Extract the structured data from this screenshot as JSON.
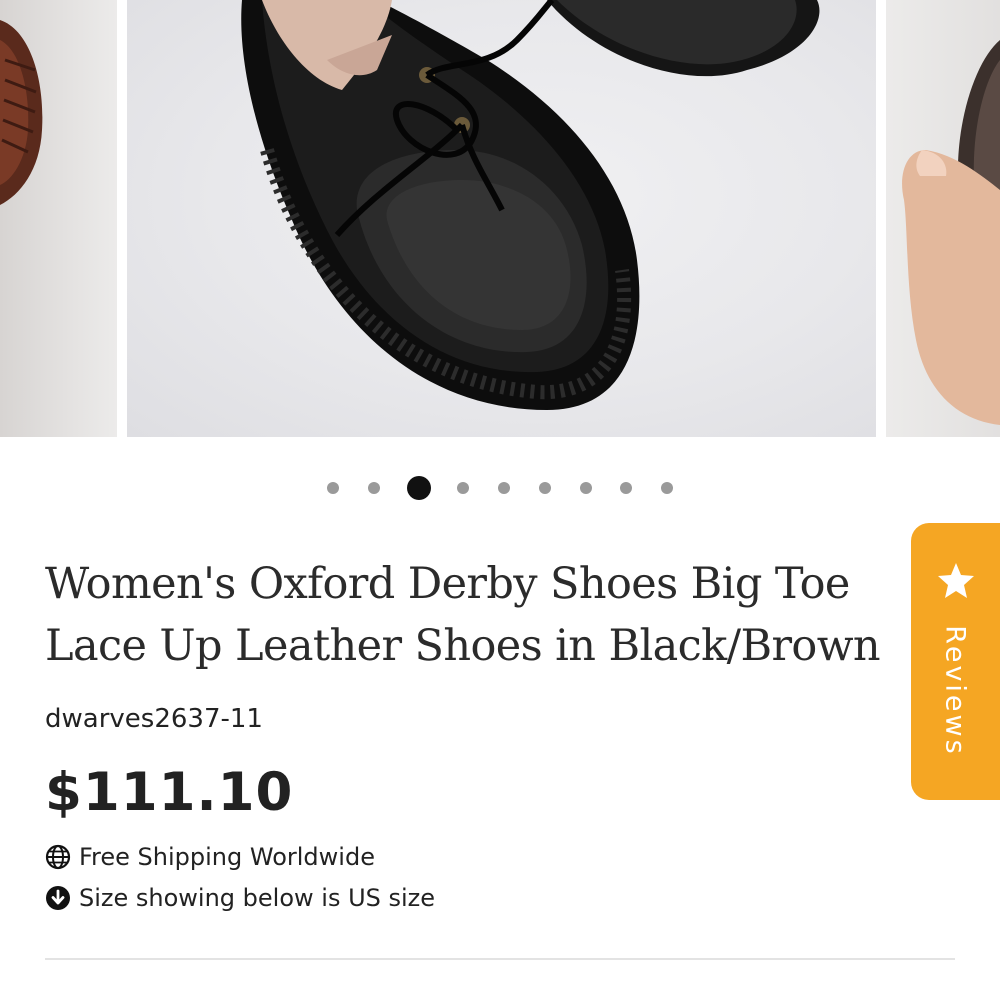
{
  "carousel": {
    "total_images": 9,
    "active_index": 2
  },
  "product": {
    "title": "Women's Oxford Derby Shoes Big Toe Lace Up Leather Shoes in Black/Brown",
    "sku": "dwarves2637-11",
    "price": "$111.10",
    "shipping_note": "Free Shipping Worldwide",
    "size_note": "Size showing below is US size"
  },
  "icons": {
    "shipping": "globe-icon",
    "size": "arrow-down-circle-icon",
    "reviews": "star-icon"
  },
  "reviews_tab": {
    "label": "Reviews",
    "color": "#f5a623"
  },
  "colors": {
    "text": "#222222",
    "active_dot": "#111111",
    "inactive_dot": "#9a9a9a"
  }
}
